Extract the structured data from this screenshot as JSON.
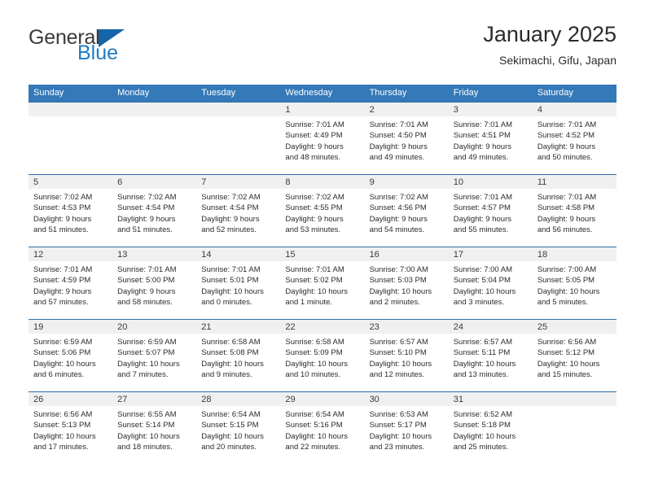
{
  "brand": {
    "name_part1": "General",
    "name_part2": "Blue",
    "triangle_icon": "triangle-icon",
    "accent_color": "#1e7bc4",
    "logo_triangle_color": "#1565a8"
  },
  "header": {
    "title": "January 2025",
    "subtitle": "Sekimachi, Gifu, Japan"
  },
  "theme": {
    "header_row_bg": "#3479b8",
    "week_border": "#2f6ea8",
    "day_band_bg": "#f0f0f0",
    "text_color": "#2b2b2b"
  },
  "weekdays": [
    "Sunday",
    "Monday",
    "Tuesday",
    "Wednesday",
    "Thursday",
    "Friday",
    "Saturday"
  ],
  "weeks": [
    [
      {
        "day": "",
        "sunrise": "",
        "sunset": "",
        "daylight_line1": "",
        "daylight_line2": ""
      },
      {
        "day": "",
        "sunrise": "",
        "sunset": "",
        "daylight_line1": "",
        "daylight_line2": ""
      },
      {
        "day": "",
        "sunrise": "",
        "sunset": "",
        "daylight_line1": "",
        "daylight_line2": ""
      },
      {
        "day": "1",
        "sunrise": "Sunrise: 7:01 AM",
        "sunset": "Sunset: 4:49 PM",
        "daylight_line1": "Daylight: 9 hours",
        "daylight_line2": "and 48 minutes."
      },
      {
        "day": "2",
        "sunrise": "Sunrise: 7:01 AM",
        "sunset": "Sunset: 4:50 PM",
        "daylight_line1": "Daylight: 9 hours",
        "daylight_line2": "and 49 minutes."
      },
      {
        "day": "3",
        "sunrise": "Sunrise: 7:01 AM",
        "sunset": "Sunset: 4:51 PM",
        "daylight_line1": "Daylight: 9 hours",
        "daylight_line2": "and 49 minutes."
      },
      {
        "day": "4",
        "sunrise": "Sunrise: 7:01 AM",
        "sunset": "Sunset: 4:52 PM",
        "daylight_line1": "Daylight: 9 hours",
        "daylight_line2": "and 50 minutes."
      }
    ],
    [
      {
        "day": "5",
        "sunrise": "Sunrise: 7:02 AM",
        "sunset": "Sunset: 4:53 PM",
        "daylight_line1": "Daylight: 9 hours",
        "daylight_line2": "and 51 minutes."
      },
      {
        "day": "6",
        "sunrise": "Sunrise: 7:02 AM",
        "sunset": "Sunset: 4:54 PM",
        "daylight_line1": "Daylight: 9 hours",
        "daylight_line2": "and 51 minutes."
      },
      {
        "day": "7",
        "sunrise": "Sunrise: 7:02 AM",
        "sunset": "Sunset: 4:54 PM",
        "daylight_line1": "Daylight: 9 hours",
        "daylight_line2": "and 52 minutes."
      },
      {
        "day": "8",
        "sunrise": "Sunrise: 7:02 AM",
        "sunset": "Sunset: 4:55 PM",
        "daylight_line1": "Daylight: 9 hours",
        "daylight_line2": "and 53 minutes."
      },
      {
        "day": "9",
        "sunrise": "Sunrise: 7:02 AM",
        "sunset": "Sunset: 4:56 PM",
        "daylight_line1": "Daylight: 9 hours",
        "daylight_line2": "and 54 minutes."
      },
      {
        "day": "10",
        "sunrise": "Sunrise: 7:01 AM",
        "sunset": "Sunset: 4:57 PM",
        "daylight_line1": "Daylight: 9 hours",
        "daylight_line2": "and 55 minutes."
      },
      {
        "day": "11",
        "sunrise": "Sunrise: 7:01 AM",
        "sunset": "Sunset: 4:58 PM",
        "daylight_line1": "Daylight: 9 hours",
        "daylight_line2": "and 56 minutes."
      }
    ],
    [
      {
        "day": "12",
        "sunrise": "Sunrise: 7:01 AM",
        "sunset": "Sunset: 4:59 PM",
        "daylight_line1": "Daylight: 9 hours",
        "daylight_line2": "and 57 minutes."
      },
      {
        "day": "13",
        "sunrise": "Sunrise: 7:01 AM",
        "sunset": "Sunset: 5:00 PM",
        "daylight_line1": "Daylight: 9 hours",
        "daylight_line2": "and 58 minutes."
      },
      {
        "day": "14",
        "sunrise": "Sunrise: 7:01 AM",
        "sunset": "Sunset: 5:01 PM",
        "daylight_line1": "Daylight: 10 hours",
        "daylight_line2": "and 0 minutes."
      },
      {
        "day": "15",
        "sunrise": "Sunrise: 7:01 AM",
        "sunset": "Sunset: 5:02 PM",
        "daylight_line1": "Daylight: 10 hours",
        "daylight_line2": "and 1 minute."
      },
      {
        "day": "16",
        "sunrise": "Sunrise: 7:00 AM",
        "sunset": "Sunset: 5:03 PM",
        "daylight_line1": "Daylight: 10 hours",
        "daylight_line2": "and 2 minutes."
      },
      {
        "day": "17",
        "sunrise": "Sunrise: 7:00 AM",
        "sunset": "Sunset: 5:04 PM",
        "daylight_line1": "Daylight: 10 hours",
        "daylight_line2": "and 3 minutes."
      },
      {
        "day": "18",
        "sunrise": "Sunrise: 7:00 AM",
        "sunset": "Sunset: 5:05 PM",
        "daylight_line1": "Daylight: 10 hours",
        "daylight_line2": "and 5 minutes."
      }
    ],
    [
      {
        "day": "19",
        "sunrise": "Sunrise: 6:59 AM",
        "sunset": "Sunset: 5:06 PM",
        "daylight_line1": "Daylight: 10 hours",
        "daylight_line2": "and 6 minutes."
      },
      {
        "day": "20",
        "sunrise": "Sunrise: 6:59 AM",
        "sunset": "Sunset: 5:07 PM",
        "daylight_line1": "Daylight: 10 hours",
        "daylight_line2": "and 7 minutes."
      },
      {
        "day": "21",
        "sunrise": "Sunrise: 6:58 AM",
        "sunset": "Sunset: 5:08 PM",
        "daylight_line1": "Daylight: 10 hours",
        "daylight_line2": "and 9 minutes."
      },
      {
        "day": "22",
        "sunrise": "Sunrise: 6:58 AM",
        "sunset": "Sunset: 5:09 PM",
        "daylight_line1": "Daylight: 10 hours",
        "daylight_line2": "and 10 minutes."
      },
      {
        "day": "23",
        "sunrise": "Sunrise: 6:57 AM",
        "sunset": "Sunset: 5:10 PM",
        "daylight_line1": "Daylight: 10 hours",
        "daylight_line2": "and 12 minutes."
      },
      {
        "day": "24",
        "sunrise": "Sunrise: 6:57 AM",
        "sunset": "Sunset: 5:11 PM",
        "daylight_line1": "Daylight: 10 hours",
        "daylight_line2": "and 13 minutes."
      },
      {
        "day": "25",
        "sunrise": "Sunrise: 6:56 AM",
        "sunset": "Sunset: 5:12 PM",
        "daylight_line1": "Daylight: 10 hours",
        "daylight_line2": "and 15 minutes."
      }
    ],
    [
      {
        "day": "26",
        "sunrise": "Sunrise: 6:56 AM",
        "sunset": "Sunset: 5:13 PM",
        "daylight_line1": "Daylight: 10 hours",
        "daylight_line2": "and 17 minutes."
      },
      {
        "day": "27",
        "sunrise": "Sunrise: 6:55 AM",
        "sunset": "Sunset: 5:14 PM",
        "daylight_line1": "Daylight: 10 hours",
        "daylight_line2": "and 18 minutes."
      },
      {
        "day": "28",
        "sunrise": "Sunrise: 6:54 AM",
        "sunset": "Sunset: 5:15 PM",
        "daylight_line1": "Daylight: 10 hours",
        "daylight_line2": "and 20 minutes."
      },
      {
        "day": "29",
        "sunrise": "Sunrise: 6:54 AM",
        "sunset": "Sunset: 5:16 PM",
        "daylight_line1": "Daylight: 10 hours",
        "daylight_line2": "and 22 minutes."
      },
      {
        "day": "30",
        "sunrise": "Sunrise: 6:53 AM",
        "sunset": "Sunset: 5:17 PM",
        "daylight_line1": "Daylight: 10 hours",
        "daylight_line2": "and 23 minutes."
      },
      {
        "day": "31",
        "sunrise": "Sunrise: 6:52 AM",
        "sunset": "Sunset: 5:18 PM",
        "daylight_line1": "Daylight: 10 hours",
        "daylight_line2": "and 25 minutes."
      },
      {
        "day": "",
        "sunrise": "",
        "sunset": "",
        "daylight_line1": "",
        "daylight_line2": ""
      }
    ]
  ]
}
